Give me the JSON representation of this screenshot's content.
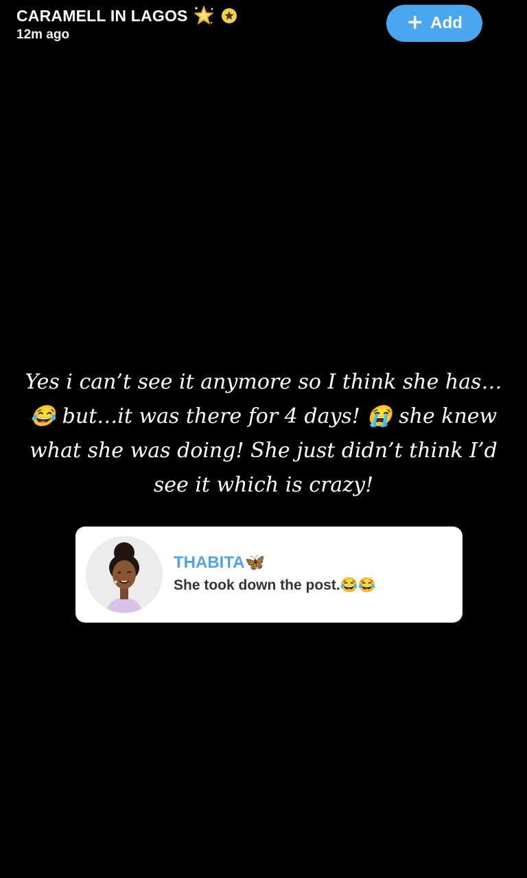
{
  "header": {
    "title": "CARAMELL IN LAGOS",
    "time": "12m ago",
    "icons": [
      "sparkle-star-icon",
      "star-badge-icon"
    ]
  },
  "add_button": {
    "icon": "plus-icon",
    "label": "Add"
  },
  "caption": {
    "line1": "Yes i can’t see it anymore so I think she has…",
    "line2": "😂 but…it was there for 4 days! 😭 she knew",
    "line3": "what she was doing! She just didn’t think I’d",
    "line4": "see it which is crazy!"
  },
  "reply": {
    "name": "THABITA🦋",
    "text": "She took down the post.😂😂",
    "avatar": "bitmoji-avatar"
  },
  "colors": {
    "background": "#000000",
    "accent": "#4aa6ee",
    "reply_name": "#4ba5e8",
    "card": "#ffffff"
  }
}
